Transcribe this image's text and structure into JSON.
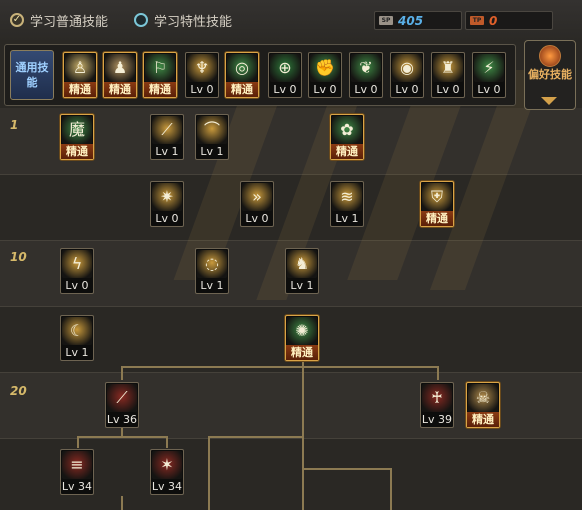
{
  "tabs": {
    "normal_label": "学习普通技能",
    "special_label": "学习特性技能"
  },
  "points": {
    "sp_icon": "SP",
    "sp_value": "405",
    "tp_icon": "TP",
    "tp_value": "0"
  },
  "common_skills": {
    "label": "通用技能",
    "items": [
      {
        "caption": "精通",
        "master": true,
        "icon": "person-sitting-icon",
        "color": "#c9b06a"
      },
      {
        "caption": "精通",
        "master": true,
        "icon": "person-kneel-icon",
        "color": "#b49562"
      },
      {
        "caption": "精通",
        "master": true,
        "icon": "run-icon",
        "color": "#3f8a45"
      },
      {
        "caption": "Lv 0",
        "master": false,
        "icon": "wings-icon",
        "color": "#c99a3c"
      },
      {
        "caption": "精通",
        "master": true,
        "icon": "target-icon",
        "color": "#3f8a45"
      },
      {
        "caption": "Lv 0",
        "master": false,
        "icon": "crosshair-icon",
        "color": "#2e7a3a"
      },
      {
        "caption": "Lv 0",
        "master": false,
        "icon": "arm-icon",
        "color": "#3f8a45"
      },
      {
        "caption": "Lv 0",
        "master": false,
        "icon": "leaf-icon",
        "color": "#3f8a45"
      },
      {
        "caption": "Lv 0",
        "master": false,
        "icon": "eye-icon",
        "color": "#c99a3c"
      },
      {
        "caption": "Lv 0",
        "master": false,
        "icon": "warrior-icon",
        "color": "#c99a3c"
      },
      {
        "caption": "Lv 0",
        "master": false,
        "icon": "runner-icon",
        "color": "#3f8a45"
      }
    ]
  },
  "pref_button": {
    "label": "偏好技能"
  },
  "levels": {
    "l1": "1",
    "l10": "10",
    "l20": "20"
  },
  "tree": [
    {
      "caption": "精通",
      "master": true,
      "icon": "demon-icon",
      "color": "#3f8a45"
    },
    {
      "caption": "Lv 1",
      "master": false,
      "icon": "slash-icon",
      "color": "#c99a3c"
    },
    {
      "caption": "Lv 1",
      "master": false,
      "icon": "arc-slash-icon",
      "color": "#c99a3c"
    },
    {
      "caption": "精通",
      "master": true,
      "icon": "sprout-icon",
      "color": "#3f8a45"
    },
    {
      "caption": "Lv 0",
      "master": false,
      "icon": "burst-icon",
      "color": "#c99a3c"
    },
    {
      "caption": "Lv 0",
      "master": false,
      "icon": "chevrons-icon",
      "color": "#c99a3c"
    },
    {
      "caption": "Lv 1",
      "master": false,
      "icon": "wave-slash-icon",
      "color": "#c99a3c"
    },
    {
      "caption": "精通",
      "master": true,
      "icon": "shield-icon",
      "color": "#c99a3c"
    },
    {
      "caption": "Lv 0",
      "master": false,
      "icon": "lightning-icon",
      "color": "#c99a3c"
    },
    {
      "caption": "Lv 1",
      "master": false,
      "icon": "whirl-icon",
      "color": "#c99a3c"
    },
    {
      "caption": "Lv 1",
      "master": false,
      "icon": "beast-icon",
      "color": "#c99a3c"
    },
    {
      "caption": "Lv 1",
      "master": false,
      "icon": "crescent-icon",
      "color": "#c99a3c"
    },
    {
      "caption": "精通",
      "master": true,
      "icon": "swirl-icon",
      "color": "#3f8a45"
    },
    {
      "caption": "Lv 36",
      "master": false,
      "icon": "red-slash-icon",
      "color": "#8a2a22"
    },
    {
      "caption": "Lv 39",
      "master": false,
      "icon": "red-figure-icon",
      "color": "#8a2a22"
    },
    {
      "caption": "精通",
      "master": true,
      "icon": "skull-icon",
      "color": "#b08a4a"
    },
    {
      "caption": "Lv 34",
      "master": false,
      "icon": "red-claw-icon",
      "color": "#8a2a22"
    },
    {
      "caption": "Lv 34",
      "master": false,
      "icon": "red-rays-icon",
      "color": "#8a2a22"
    }
  ]
}
